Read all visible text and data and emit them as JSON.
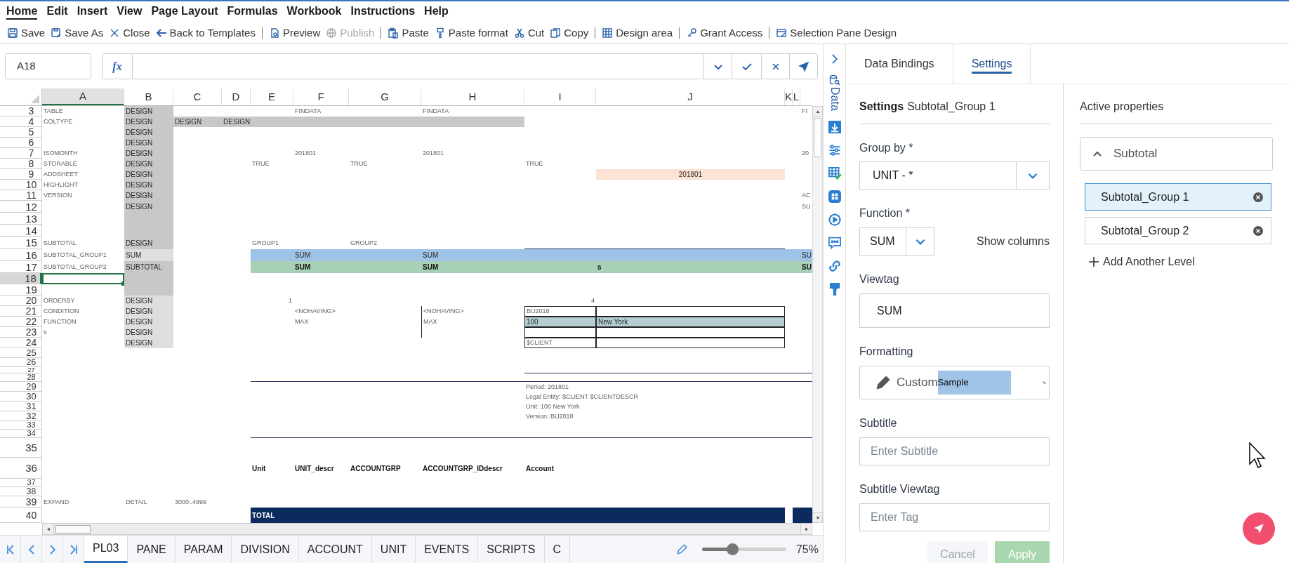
{
  "menu": [
    {
      "label": "Home",
      "selected": true
    },
    {
      "label": "Edit",
      "selected": false
    },
    {
      "label": "Insert",
      "selected": false
    },
    {
      "label": "View",
      "selected": false
    },
    {
      "label": "Page Layout",
      "selected": false
    },
    {
      "label": "Formulas",
      "selected": false
    },
    {
      "label": "Workbook",
      "selected": false
    },
    {
      "label": "Instructions",
      "selected": false
    },
    {
      "label": "Help",
      "selected": false
    }
  ],
  "toolbar": {
    "groups": [
      [
        {
          "label": "Save",
          "disabled": false
        },
        {
          "label": "Save As",
          "disabled": false
        },
        {
          "label": "Close",
          "disabled": false
        },
        {
          "label": "Back to Templates",
          "disabled": false
        }
      ],
      [
        {
          "label": "Preview",
          "disabled": false
        },
        {
          "label": "Publish",
          "disabled": true
        }
      ],
      [
        {
          "label": "Paste",
          "disabled": false
        },
        {
          "label": "Paste format",
          "disabled": false
        },
        {
          "label": "Cut",
          "disabled": false
        },
        {
          "label": "Copy",
          "disabled": false
        }
      ],
      [
        {
          "label": "Design area",
          "disabled": false
        }
      ],
      [
        {
          "label": "Grant Access",
          "disabled": false
        }
      ],
      [
        {
          "label": "Selection Pane Design",
          "disabled": false
        }
      ]
    ]
  },
  "formula_bar": {
    "cell_reference": "A18",
    "function_button": "fx"
  },
  "sheet": {
    "columns": [
      {
        "label": "A",
        "selected": true
      },
      {
        "label": "B",
        "selected": false
      },
      {
        "label": "C",
        "selected": false
      },
      {
        "label": "D",
        "selected": false
      },
      {
        "label": "E",
        "selected": false
      },
      {
        "label": "F",
        "selected": false
      },
      {
        "label": "G",
        "selected": false
      },
      {
        "label": "H",
        "selected": false
      },
      {
        "label": "I",
        "selected": false
      },
      {
        "label": "J",
        "selected": false
      },
      {
        "label": "K",
        "selected": false
      },
      {
        "label": "L",
        "selected": false
      }
    ],
    "rows": [
      {
        "number": "3",
        "selected": false,
        "cells": [
          {
            "text": "TABLE"
          },
          {
            "text": "DESIGN",
            "color": "#c8c8c8"
          },
          null,
          null,
          null,
          {
            "text": "FINDATA"
          },
          null,
          {
            "text": "FINDATA"
          },
          null,
          null,
          null,
          null,
          {
            "text": "FI"
          }
        ]
      },
      {
        "number": "4",
        "selected": false,
        "cells": [
          {
            "text": "COLTYPE"
          },
          {
            "text": "DESIGN",
            "color": "#c8c8c8"
          },
          {
            "text": "DESIGN",
            "color": "#c8c8c8"
          },
          {
            "text": "DESIGN",
            "color": "#c8c8c8"
          },
          {
            "color": "#c8c8c8"
          },
          {
            "color": "#c8c8c8"
          },
          {
            "color": "#c8c8c8"
          },
          {
            "color": "#c8c8c8"
          }
        ]
      },
      {
        "number": "5",
        "selected": false,
        "cells": [
          null,
          {
            "text": "DESIGN",
            "color": "#c8c8c8"
          }
        ]
      },
      {
        "number": "6",
        "selected": false,
        "cells": [
          null,
          {
            "text": "DESIGN",
            "color": "#c8c8c8"
          }
        ]
      },
      {
        "number": "7",
        "selected": false,
        "cells": [
          {
            "text": "ISOMONTH"
          },
          {
            "text": "DESIGN",
            "color": "#c8c8c8"
          },
          null,
          null,
          null,
          {
            "text": "201801"
          },
          null,
          {
            "text": "201801"
          },
          null,
          null,
          null,
          null,
          {
            "text": "20"
          }
        ]
      },
      {
        "number": "8",
        "selected": false,
        "cells": [
          {
            "text": "STORABLE"
          },
          {
            "text": "DESIGN",
            "color": "#c8c8c8"
          },
          null,
          null,
          {
            "text": "TRUE"
          },
          null,
          {
            "text": "TRUE"
          },
          null,
          {
            "text": "TRUE"
          }
        ]
      },
      {
        "number": "9",
        "selected": false,
        "cells": [
          {
            "text": "ADDSHEET"
          },
          {
            "text": "DESIGN",
            "color": "#c8c8c8"
          },
          null,
          null,
          null,
          null,
          null,
          null,
          null,
          {
            "text": "201801",
            "color": "#fbe2d2",
            "centered": true
          }
        ]
      },
      {
        "number": "10",
        "selected": false,
        "cells": [
          {
            "text": "HIGHLIGHT"
          },
          {
            "text": "DESIGN",
            "color": "#c8c8c8"
          }
        ]
      },
      {
        "number": "11",
        "selected": false,
        "cells": [
          {
            "text": "VERSION"
          },
          {
            "text": "DESIGN",
            "color": "#c8c8c8"
          },
          null,
          null,
          null,
          null,
          null,
          null,
          null,
          null,
          null,
          null,
          {
            "text": "AC"
          }
        ]
      },
      {
        "number": "12",
        "selected": false,
        "cells": [
          null,
          {
            "text": "DESIGN",
            "color": "#c8c8c8"
          },
          null,
          null,
          null,
          null,
          null,
          null,
          null,
          null,
          null,
          null,
          {
            "text": "SU"
          }
        ]
      },
      {
        "number": "13",
        "selected": false,
        "cells": [
          null,
          {
            "color": "#c8c8c8"
          }
        ]
      },
      {
        "number": "14",
        "selected": false,
        "cells": [
          null,
          {
            "color": "#c8c8c8"
          }
        ]
      },
      {
        "number": "15",
        "selected": false,
        "cells": [
          {
            "text": "SUBTOTAL"
          },
          {
            "text": "DESIGN",
            "color": "#c8c8c8"
          },
          null,
          null,
          {
            "text": "GROUP1"
          },
          null,
          {
            "text": "GROUP2"
          },
          null,
          {
            "rule_below": true
          },
          {
            "rule_below": true
          }
        ]
      },
      {
        "number": "16",
        "selected": false,
        "cells": [
          {
            "text": "SUBTOTAL_GROUP1"
          },
          {
            "text": "SUM",
            "color": "#dedede"
          },
          null,
          null,
          {
            "color": "#9fc2e7"
          },
          {
            "text": "SUM",
            "color": "#9fc2e7"
          },
          {
            "color": "#9fc2e7"
          },
          {
            "text": "SUM",
            "color": "#9fc2e7"
          },
          {
            "color": "#9fc2e7"
          },
          {
            "color": "#9fc2e7"
          },
          {
            "color": "#9fc2e7"
          },
          {
            "color": "#9fc2e7"
          },
          {
            "text": "SU",
            "color": "#9fc2e7"
          }
        ]
      },
      {
        "number": "17",
        "selected": false,
        "cells": [
          {
            "text": "SUBTOTAL_GROUP2"
          },
          {
            "text": "SUBTOTAL",
            "color": "#c8c8c8"
          },
          null,
          null,
          {
            "color": "#a8d0b6"
          },
          {
            "text": "SUM",
            "color": "#a8d0b6",
            "bold": true
          },
          {
            "color": "#a8d0b6"
          },
          {
            "text": "SUM",
            "color": "#a8d0b6",
            "bold": true
          },
          {
            "color": "#a8d0b6"
          },
          {
            "text": "s",
            "color": "#a8d0b6",
            "bold": true
          },
          {
            "color": "#a8d0b6"
          },
          {
            "color": "#a8d0b6"
          },
          {
            "text": "SU",
            "color": "#a8d0b6",
            "bold": true
          }
        ]
      },
      {
        "number": "18",
        "selected": true,
        "cells": [
          null,
          {
            "color": "#c8c8c8"
          }
        ]
      },
      {
        "number": "19",
        "selected": false,
        "cells": [
          null,
          {
            "color": "#c8c8c8"
          }
        ]
      },
      {
        "number": "20",
        "selected": false,
        "cells": [
          {
            "text": "ORDERBY"
          },
          {
            "text": "DESIGN",
            "color": "#dedede"
          },
          null,
          null,
          {
            "text": "1",
            "right_aligned": true
          },
          null,
          null,
          null,
          {
            "text": "4",
            "right_aligned": true
          }
        ]
      },
      {
        "number": "21",
        "selected": false,
        "cells": [
          {
            "text": "CONDITION"
          },
          {
            "text": "DESIGN",
            "color": "#dedede"
          },
          null,
          null,
          null,
          {
            "text": "<NOHAVING>"
          },
          null,
          {
            "text": "<NOHAVING>",
            "rule_left": true
          },
          {
            "text": "BU2018",
            "outline": true
          },
          {
            "outline": true
          }
        ]
      },
      {
        "number": "22",
        "selected": false,
        "cells": [
          {
            "text": "FUNCTION"
          },
          {
            "text": "DESIGN",
            "color": "#dedede"
          },
          null,
          null,
          null,
          {
            "text": "MAX"
          },
          null,
          {
            "text": "MAX",
            "rule_left": true
          },
          {
            "text": "100",
            "color": "#b5ced3",
            "outline": true
          },
          {
            "text": "New York",
            "color": "#b5ced3",
            "outline": true
          }
        ]
      },
      {
        "number": "23",
        "selected": false,
        "cells": [
          {
            "text": "s"
          },
          {
            "text": "DESIGN",
            "color": "#dedede"
          },
          null,
          null,
          null,
          null,
          null,
          {
            "rule_left": true
          },
          {
            "outline": true
          },
          {
            "outline": true
          }
        ]
      },
      {
        "number": "24",
        "selected": false,
        "cells": [
          null,
          {
            "text": "DESIGN",
            "color": "#dedede"
          },
          null,
          null,
          null,
          null,
          null,
          null,
          {
            "text": "$CLIENT",
            "outline": true
          },
          {
            "outline": true
          }
        ]
      },
      {
        "number": "25",
        "selected": false
      },
      {
        "number": "26",
        "selected": false
      },
      {
        "number": "27",
        "selected": false,
        "cells": [
          null,
          null,
          null,
          null,
          null,
          null,
          null,
          null,
          {
            "rule_below": true
          },
          {
            "rule_below": true
          },
          {
            "rule_below": true
          },
          {
            "rule_below": true
          },
          {
            "rule_below": true
          }
        ]
      },
      {
        "number": "28",
        "selected": false,
        "cells": [
          null,
          null,
          null,
          null,
          {
            "rule_below": true
          },
          {
            "rule_below": true
          },
          {
            "rule_below": true
          },
          {
            "rule_below": true
          },
          {
            "rule_below": true
          },
          {
            "rule_below": true
          },
          {
            "rule_below": true
          },
          {
            "rule_below": true
          },
          {
            "rule_below": true
          }
        ]
      },
      {
        "number": "29",
        "selected": false,
        "cells": [
          null,
          null,
          null,
          null,
          null,
          null,
          null,
          null,
          {
            "text": "Period: 201801"
          }
        ]
      },
      {
        "number": "30",
        "selected": false,
        "cells": [
          null,
          null,
          null,
          null,
          null,
          null,
          null,
          null,
          {
            "text": "Legal Entity: $CLIENT $CLIENTDESCR"
          }
        ]
      },
      {
        "number": "31",
        "selected": false,
        "cells": [
          null,
          null,
          null,
          null,
          null,
          null,
          null,
          null,
          {
            "text": "Unit: 100 New York"
          }
        ]
      },
      {
        "number": "32",
        "selected": false,
        "cells": [
          null,
          null,
          null,
          null,
          null,
          null,
          null,
          null,
          {
            "text": "Version: BU2018"
          }
        ]
      },
      {
        "number": "33",
        "selected": false
      },
      {
        "number": "34",
        "selected": false,
        "cells": [
          null,
          null,
          null,
          null,
          {
            "rule_below": true
          },
          {
            "rule_below": true
          },
          {
            "rule_below": true
          },
          {
            "rule_below": true
          },
          {
            "rule_below": true
          },
          {
            "rule_below": true
          },
          {
            "rule_below": true
          },
          {
            "rule_below": true
          },
          {
            "rule_below": true
          }
        ]
      },
      {
        "number": "35",
        "selected": false
      },
      {
        "number": "36",
        "selected": false,
        "cells": [
          null,
          null,
          null,
          null,
          {
            "text": "Unit",
            "bold": true
          },
          {
            "text": "UNIT_descr",
            "bold": true
          },
          {
            "text": "ACCOUNTGRP",
            "bold": true
          },
          {
            "text": "ACCOUNTGRP_IDdescr",
            "bold": true
          },
          {
            "text": "Account",
            "bold": true
          }
        ]
      },
      {
        "number": "37",
        "selected": false
      },
      {
        "number": "38",
        "selected": false
      },
      {
        "number": "39",
        "selected": false,
        "cells": [
          {
            "text": "EXPAND"
          },
          {
            "text": "DETAIL"
          },
          {
            "text": "3000..4999"
          }
        ]
      },
      {
        "number": "40",
        "selected": false,
        "cells": [
          null,
          null,
          null,
          null,
          {
            "text": "TOTAL",
            "color": "#0b2b5e",
            "bold": true
          },
          {
            "color": "#0b2b5e"
          },
          {
            "color": "#0b2b5e"
          },
          {
            "color": "#0b2b5e"
          },
          {
            "color": "#0b2b5e"
          },
          {
            "color": "#0b2b5e"
          },
          null,
          {
            "color": "#0b2b5e"
          },
          {
            "color": "#0b2b5e"
          }
        ]
      }
    ]
  },
  "sheet_tabs": [
    {
      "label": "PL03",
      "selected": true
    },
    {
      "label": "PANE",
      "selected": false
    },
    {
      "label": "PARAM",
      "selected": false
    },
    {
      "label": "DIVISION",
      "selected": false
    },
    {
      "label": "ACCOUNT",
      "selected": false
    },
    {
      "label": "UNIT",
      "selected": false
    },
    {
      "label": "EVENTS",
      "selected": false
    },
    {
      "label": "SCRIPTS",
      "selected": false
    },
    {
      "label": "C",
      "selected": false
    }
  ],
  "zoom": {
    "level": 0.35,
    "reading": "75%"
  },
  "side_strip": {
    "data_label": "Data"
  },
  "panel": {
    "tabs": [
      {
        "label": "Data Bindings",
        "selected": false
      },
      {
        "label": "Settings",
        "selected": true
      }
    ],
    "settings": {
      "heading": "Settings",
      "subject": "Subtotal_Group 1",
      "group_by": {
        "label": "Group by *",
        "value": "UNIT - *"
      },
      "function": {
        "label": "Function *",
        "value": "SUM"
      },
      "show_columns": "Show columns",
      "viewtag": {
        "label": "Viewtag",
        "value": "SUM"
      },
      "formatting": {
        "label": "Formatting",
        "value": "Custom",
        "sample": "Sample"
      },
      "subtitle": {
        "label": "Subtitle",
        "placeholder": "Enter Subtitle"
      },
      "subtitle_viewtag": {
        "label": "Subtitle Viewtag",
        "placeholder": "Enter Tag"
      },
      "buttons": [
        {
          "label": "Cancel",
          "kind": "cancel",
          "disabled": true
        },
        {
          "label": "Apply",
          "kind": "apply",
          "disabled": true
        }
      ]
    },
    "active_properties": {
      "title": "Active properties",
      "section": {
        "label": "Subtotal",
        "expanded": true
      },
      "levels": [
        {
          "label": "Subtotal_Group 1",
          "selected": true
        },
        {
          "label": "Subtotal_Group 2",
          "selected": false
        }
      ],
      "add_button": "Add Another Level"
    }
  }
}
